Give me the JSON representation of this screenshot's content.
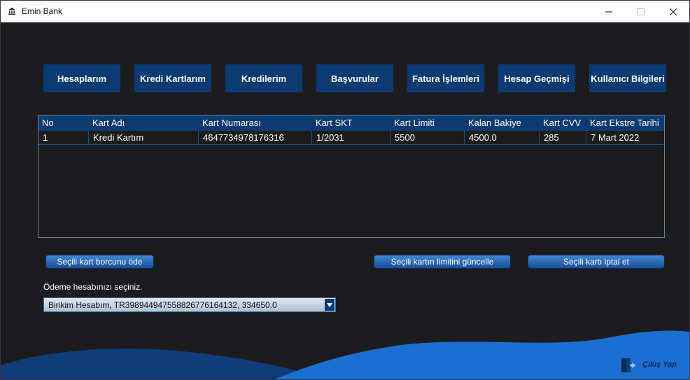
{
  "window": {
    "title": "Emin Bank",
    "icon": "bank-icon"
  },
  "nav": [
    {
      "label": "Hesaplarım"
    },
    {
      "label": "Kredi Kartlarım"
    },
    {
      "label": "Kredilerim"
    },
    {
      "label": "Başvurular"
    },
    {
      "label": "Fatura İşlemleri"
    },
    {
      "label": "Hesap Geçmişi"
    },
    {
      "label": "Kullanıcı Bilgileri"
    }
  ],
  "table": {
    "columns": [
      "No",
      "Kart Adı",
      "Kart Numarası",
      "Kart SKT",
      "Kart Limiti",
      "Kalan Bakiye",
      "Kart CVV",
      "Kart Ekstre Tarihi"
    ],
    "rows": [
      [
        "1",
        "Kredi Kartım",
        "4647734978176316",
        "1/2031",
        "5500",
        "4500.0",
        "285",
        "7 Mart 2022"
      ]
    ]
  },
  "actions": {
    "pay": "Seçili kart borcunu öde",
    "update_limit": "Seçili kartın limitini güncelle",
    "cancel_card": "Seçili kartı iptal et"
  },
  "payment": {
    "label": "Ödeme hesabınızı seçiniz.",
    "selected": "Birikim Hesabım, TR398944947558826776164132, 334650.0"
  },
  "footer": {
    "exit_label": "Çıkış Yap",
    "exit_icon": "logout-icon"
  },
  "colors": {
    "background": "#1c1c1f",
    "nav_button": "#0b3b73",
    "wave_dark": "#0f3d78",
    "wave_light": "#1b6fd0"
  }
}
